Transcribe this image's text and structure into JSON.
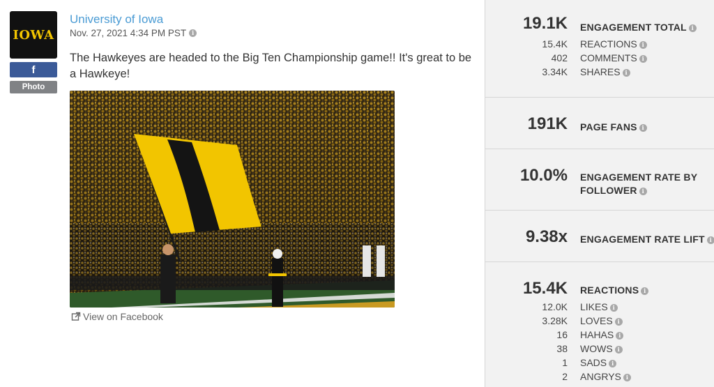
{
  "post": {
    "logo_text": "IOWA",
    "network_icon": "facebook-icon",
    "network_glyph": "f",
    "type_label": "Photo",
    "author": "University of Iowa",
    "date": "Nov. 27, 2021 4:34 PM PST",
    "message": "The Hawkeyes are headed to the Big Ten Championship game!! It's great to be a Hawkeye!",
    "view_link": "View on Facebook"
  },
  "metrics": {
    "engagement_total": {
      "value": "19.1K",
      "label": "ENGAGEMENT TOTAL"
    },
    "engagement_breakdown": [
      {
        "value": "15.4K",
        "label": "REACTIONS"
      },
      {
        "value": "402",
        "label": "COMMENTS"
      },
      {
        "value": "3.34K",
        "label": "SHARES"
      }
    ],
    "page_fans": {
      "value": "191K",
      "label": "PAGE FANS"
    },
    "engagement_rate": {
      "value": "10.0%",
      "label": "ENGAGEMENT RATE BY FOLLOWER"
    },
    "engagement_lift": {
      "value": "9.38x",
      "label": "ENGAGEMENT RATE LIFT"
    },
    "reactions": {
      "value": "15.4K",
      "label": "REACTIONS"
    },
    "reactions_breakdown": [
      {
        "value": "12.0K",
        "label": "LIKES"
      },
      {
        "value": "3.28K",
        "label": "LOVES"
      },
      {
        "value": "16",
        "label": "HAHAS"
      },
      {
        "value": "38",
        "label": "WOWS"
      },
      {
        "value": "1",
        "label": "SADS"
      },
      {
        "value": "2",
        "label": "ANGRYS"
      }
    ]
  },
  "colors": {
    "brand_gold": "#f2c500",
    "facebook_blue": "#3b5a98",
    "link_blue": "#4a9bd4"
  }
}
